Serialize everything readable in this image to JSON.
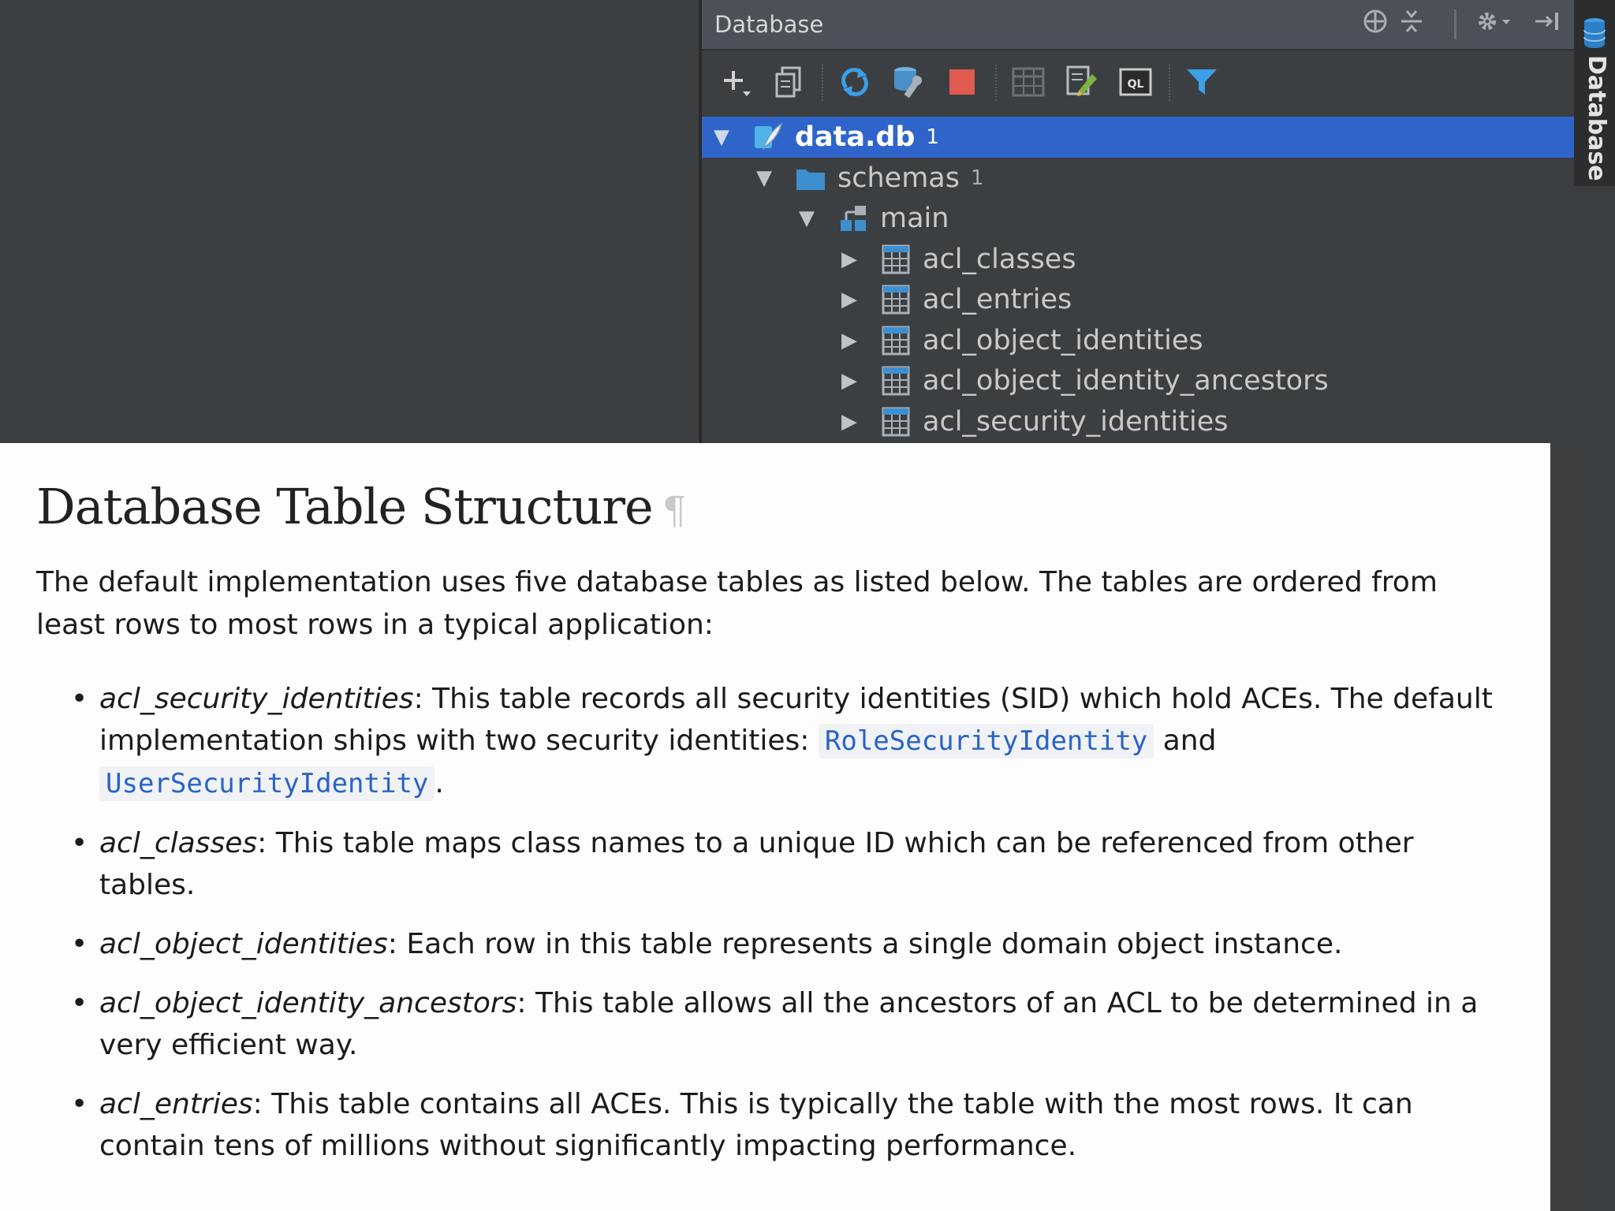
{
  "panel": {
    "title": "Database",
    "header_icons": [
      "crosshair-icon",
      "collapse-all-icon",
      "gear-icon",
      "hide-icon"
    ],
    "toolbar_icons": [
      "add-icon",
      "copy-icon",
      "refresh-icon",
      "schema-tools-icon",
      "stop-icon",
      "table-grid-icon",
      "edit-icon",
      "sql-console-icon",
      "filter-icon"
    ],
    "sql_console_label": "QL"
  },
  "tree": [
    {
      "label": "data.db",
      "count": "1",
      "level": 0,
      "icon": "sqlite-feather-icon",
      "expanded": true,
      "selected": true
    },
    {
      "label": "schemas",
      "count": "1",
      "level": 1,
      "icon": "folder-icon",
      "expanded": true,
      "selected": false
    },
    {
      "label": "main",
      "count": "",
      "level": 2,
      "icon": "schema-icon",
      "expanded": true,
      "selected": false
    },
    {
      "label": "acl_classes",
      "count": "",
      "level": 3,
      "icon": "table-icon",
      "expanded": false,
      "selected": false
    },
    {
      "label": "acl_entries",
      "count": "",
      "level": 3,
      "icon": "table-icon",
      "expanded": false,
      "selected": false
    },
    {
      "label": "acl_object_identities",
      "count": "",
      "level": 3,
      "icon": "table-icon",
      "expanded": false,
      "selected": false
    },
    {
      "label": "acl_object_identity_ancestors",
      "count": "",
      "level": 3,
      "icon": "table-icon",
      "expanded": false,
      "selected": false
    },
    {
      "label": "acl_security_identities",
      "count": "",
      "level": 3,
      "icon": "table-icon",
      "expanded": false,
      "selected": false
    }
  ],
  "side_strip": {
    "label": "Database"
  },
  "doc": {
    "title": "Database Table Structure",
    "pilcrow": "¶",
    "intro": "The default implementation uses five database tables as listed below. The tables are ordered from least rows to most rows in a typical application:",
    "items": [
      {
        "term": "acl_security_identities",
        "text": ": This table records all security identities (SID) which hold ACEs. The default implementation ships with two security identities: ",
        "code1": "RoleSecurityIdentity",
        "mid": " and ",
        "code2": "UserSecurityIdentity",
        "end": "."
      },
      {
        "term": "acl_classes",
        "text": ": This table maps class names to a unique ID which can be referenced from other tables."
      },
      {
        "term": "acl_object_identities",
        "text": ": Each row in this table represents a single domain object instance."
      },
      {
        "term": "acl_object_identity_ancestors",
        "text": ": This table allows all the ancestors of an ACL to be determined in a very efficient way."
      },
      {
        "term": "acl_entries",
        "text": ": This table contains all ACEs. This is typically the table with the most rows. It can contain tens of millions without significantly impacting performance."
      }
    ],
    "bullet": "•"
  }
}
